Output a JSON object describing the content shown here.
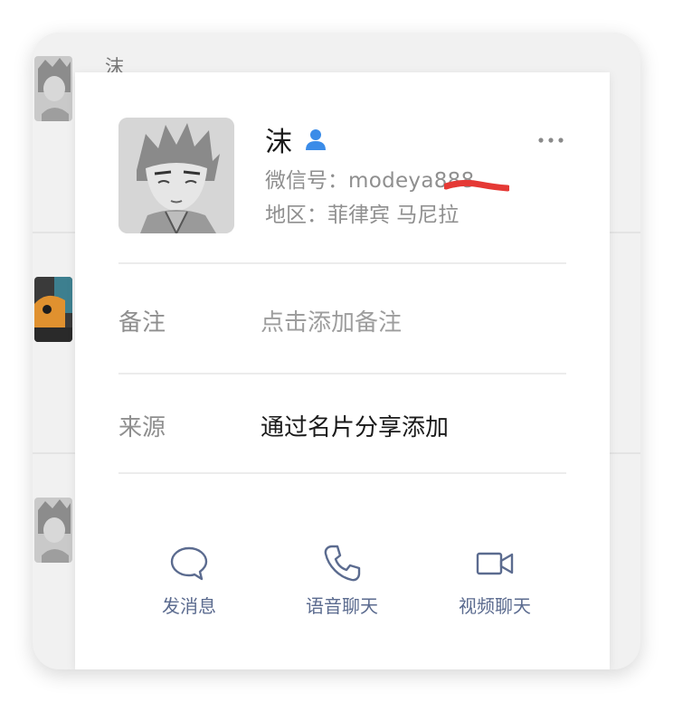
{
  "background_list": {
    "first_name_char": "沫"
  },
  "profile": {
    "name": "沫",
    "wechat_id_label": "微信号：",
    "wechat_id_value": "modeya888",
    "region_label": "地区：",
    "region_value": "菲律宾 马尼拉"
  },
  "fields": {
    "remark_label": "备注",
    "remark_placeholder": "点击添加备注",
    "source_label": "来源",
    "source_value": "通过名片分享添加"
  },
  "actions": {
    "message": "发消息",
    "voice": "语音聊天",
    "video": "视频聊天"
  },
  "icons": {
    "contact": "person-icon",
    "more": "more-icon",
    "message": "chat-bubble-icon",
    "voice": "phone-icon",
    "video": "video-camera-icon"
  },
  "colors": {
    "accent_blue": "#3b8ce8",
    "action_blue": "#5b6b8f",
    "redaction_red": "#e53935"
  }
}
